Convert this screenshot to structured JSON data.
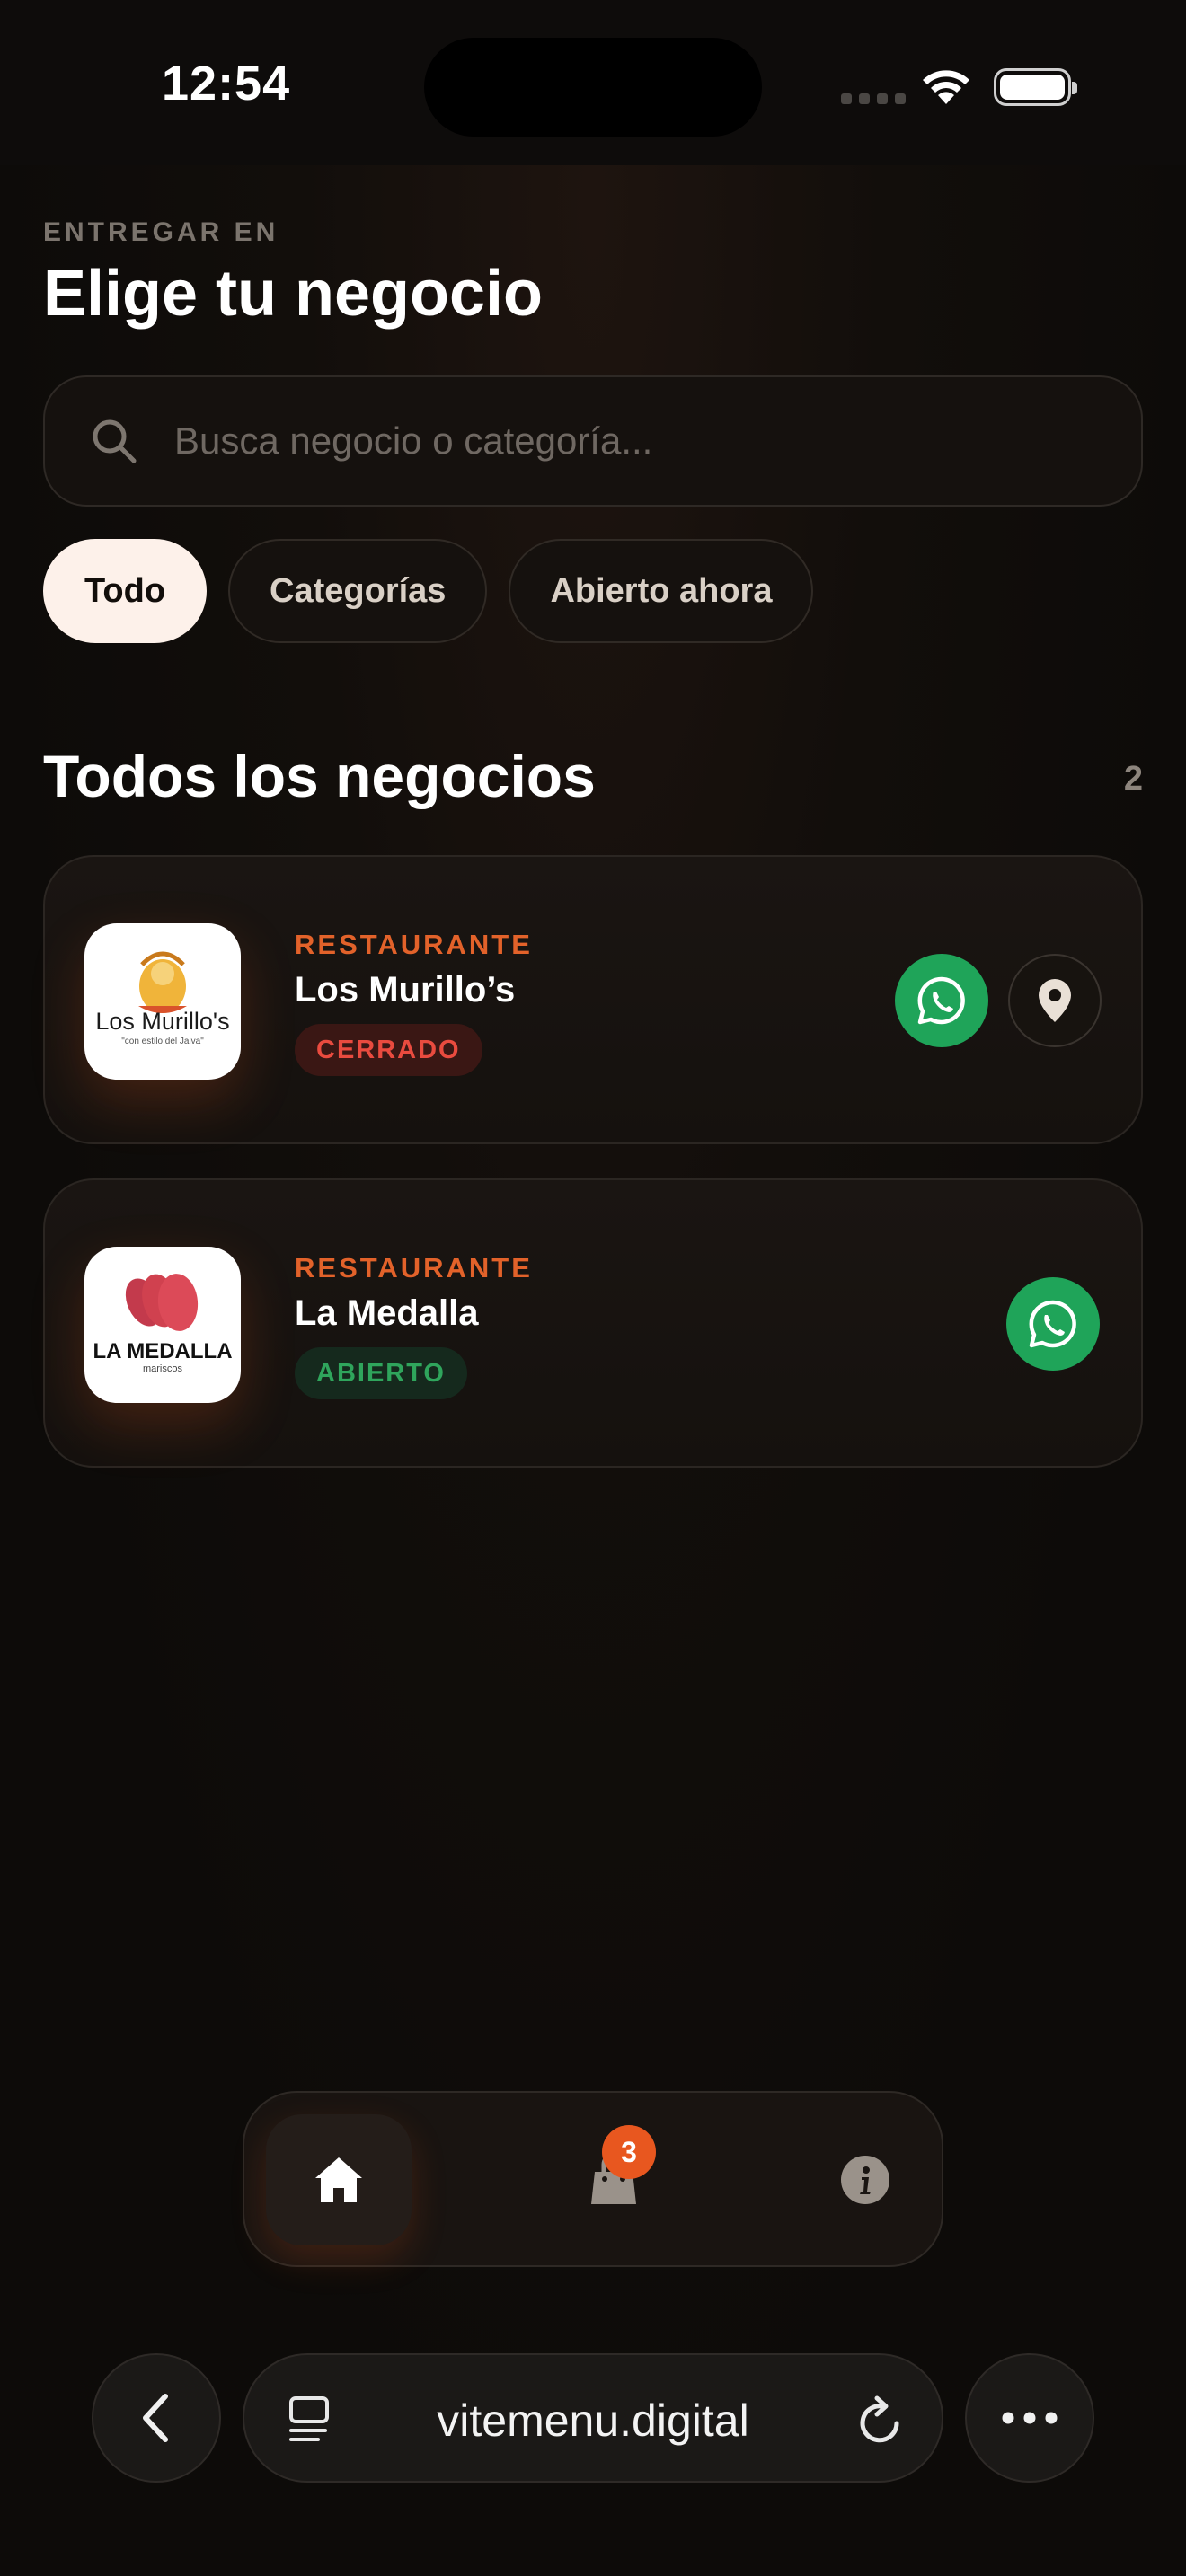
{
  "status_bar": {
    "time": "12:54"
  },
  "header": {
    "deliver_label": "ENTREGAR EN",
    "title": "Elige tu negocio"
  },
  "search": {
    "placeholder": "Busca negocio o categoría..."
  },
  "filters": [
    {
      "label": "Todo",
      "active": true
    },
    {
      "label": "Categorías",
      "active": false
    },
    {
      "label": "Abierto ahora",
      "active": false
    }
  ],
  "section": {
    "title": "Todos los negocios",
    "count": "2"
  },
  "businesses": [
    {
      "category": "RESTAURANTE",
      "name": "Los Murillo’s",
      "status": "CERRADO",
      "logo_text": "Los Murillo's",
      "logo_subtext": "\"con estilo del Jaiva\"",
      "actions": [
        "whatsapp-icon",
        "location-pin-icon"
      ]
    },
    {
      "category": "RESTAURANTE",
      "name": "La Medalla",
      "status": "ABIERTO",
      "logo_text": "LA MEDALLA",
      "logo_subtext": "mariscos",
      "actions": [
        "whatsapp-icon"
      ]
    }
  ],
  "bottom_nav": {
    "items": [
      "home-icon",
      "shopping-bag-icon",
      "info-icon"
    ],
    "cart_count": "3"
  },
  "browser": {
    "url": "vitemenu.digital"
  },
  "colors": {
    "accent": "#e2622a",
    "closed": "#e94b3f",
    "open": "#2fa55c",
    "whatsapp": "#1fa459",
    "background": "#0d0b09"
  }
}
